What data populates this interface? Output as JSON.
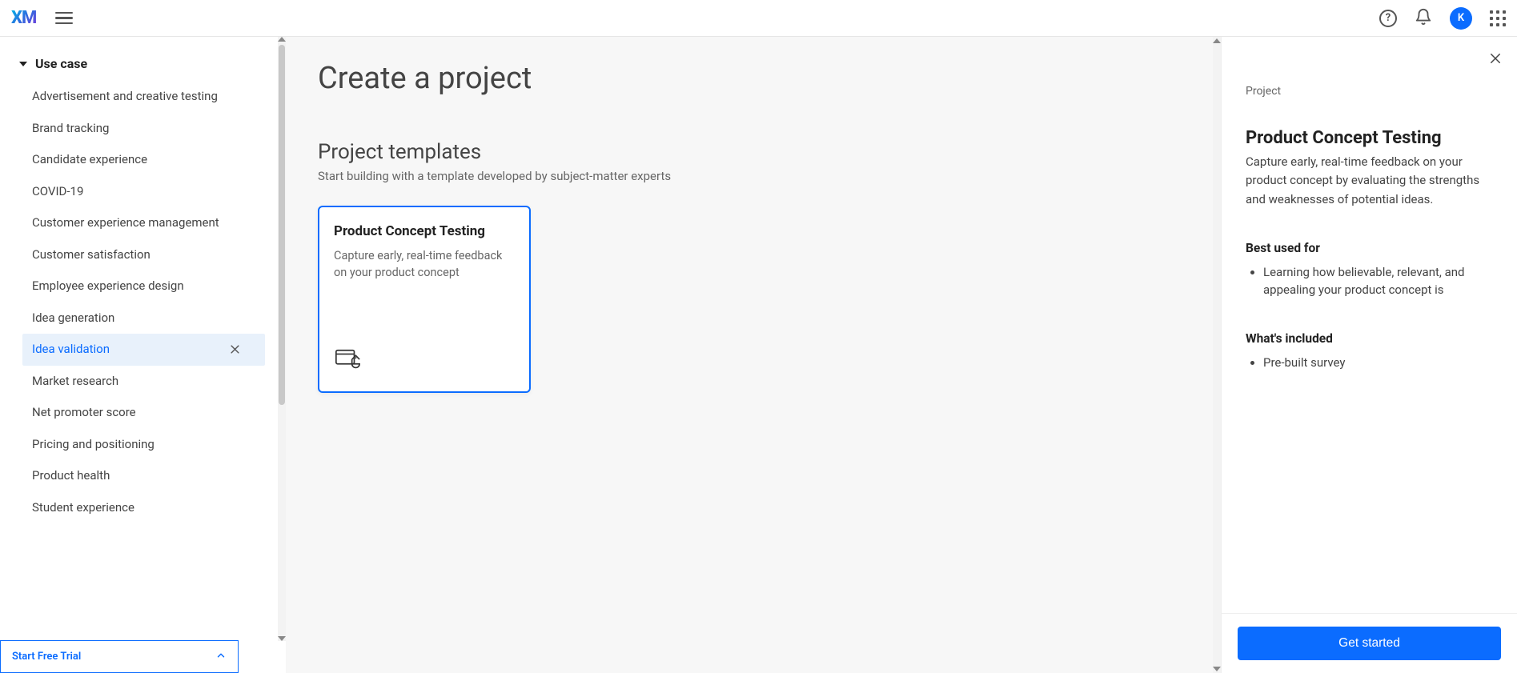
{
  "header": {
    "brand": "XM",
    "avatar_initial": "K"
  },
  "sidebar": {
    "section_label": "Use case",
    "trial_label": "Start Free Trial",
    "items": [
      {
        "label": "Advertisement and creative testing"
      },
      {
        "label": "Brand tracking"
      },
      {
        "label": "Candidate experience"
      },
      {
        "label": "COVID-19"
      },
      {
        "label": "Customer experience management"
      },
      {
        "label": "Customer satisfaction"
      },
      {
        "label": "Employee experience design"
      },
      {
        "label": "Idea generation"
      },
      {
        "label": "Idea validation"
      },
      {
        "label": "Market research"
      },
      {
        "label": "Net promoter score"
      },
      {
        "label": "Pricing and positioning"
      },
      {
        "label": "Product health"
      },
      {
        "label": "Student experience"
      }
    ],
    "active_index": 8
  },
  "main": {
    "heading": "Create a project",
    "templates_heading": "Project templates",
    "templates_sub": "Start building with a template developed by subject-matter experts",
    "card": {
      "title": "Product Concept Testing",
      "desc": "Capture early, real-time feedback on your product concept"
    }
  },
  "detail": {
    "eyebrow": "Project",
    "title": "Product Concept Testing",
    "desc": "Capture early, real-time feedback on your product concept by evaluating the strengths and weaknesses of potential ideas.",
    "best_used_label": "Best used for",
    "best_used_items": [
      "Learning how believable, relevant, and appealing your product concept is"
    ],
    "included_label": "What's included",
    "included_items": [
      "Pre-built survey"
    ],
    "cta_label": "Get started"
  }
}
